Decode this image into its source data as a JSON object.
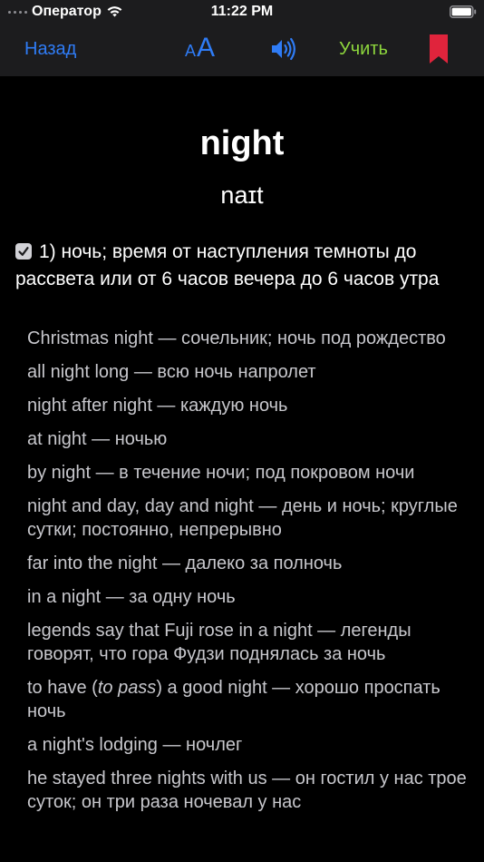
{
  "status_bar": {
    "carrier": "Оператор",
    "time": "11:22 PM"
  },
  "nav": {
    "back_label": "Назад",
    "font_small": "A",
    "font_big": "A",
    "learn_label": "Учить",
    "icons": [
      "wifi-icon",
      "battery-icon",
      "speaker-icon",
      "bookmark-icon"
    ],
    "accent_color": "#2f7cf6",
    "learn_color": "#8dd63d",
    "bookmark_color": "#e0243c"
  },
  "entry": {
    "word": "night",
    "transcription": "naɪt",
    "sense_text": "1) ночь; время от наступления темноты до рассвета или от 6 часов вечера до 6 часов утра",
    "examples": [
      {
        "text": "Christmas night — сочельник; ночь под рождество"
      },
      {
        "text": "all night long — всю ночь напролет"
      },
      {
        "text": "night after night — каждую ночь"
      },
      {
        "text": "at night — ночью"
      },
      {
        "text": "by night — в течение ночи; под покровом ночи"
      },
      {
        "text": "night and day, day and night — день и ночь; круглые сутки; постоянно, непрерывно"
      },
      {
        "text": "far into the night — далеко за полночь"
      },
      {
        "text": "in a night — за одну ночь"
      },
      {
        "text": "legends say that Fuji rose in a night — легенды говорят, что гора Фудзи поднялась за ночь"
      },
      {
        "pre": "to have (",
        "italic": "to pass",
        "post": ") a good night — хорошо проспать ночь"
      },
      {
        "text": "a night's lodging — ночлег"
      },
      {
        "text": "he stayed three nights with us — он гостил у нас трое суток; он три раза ночевал у нас"
      }
    ]
  }
}
